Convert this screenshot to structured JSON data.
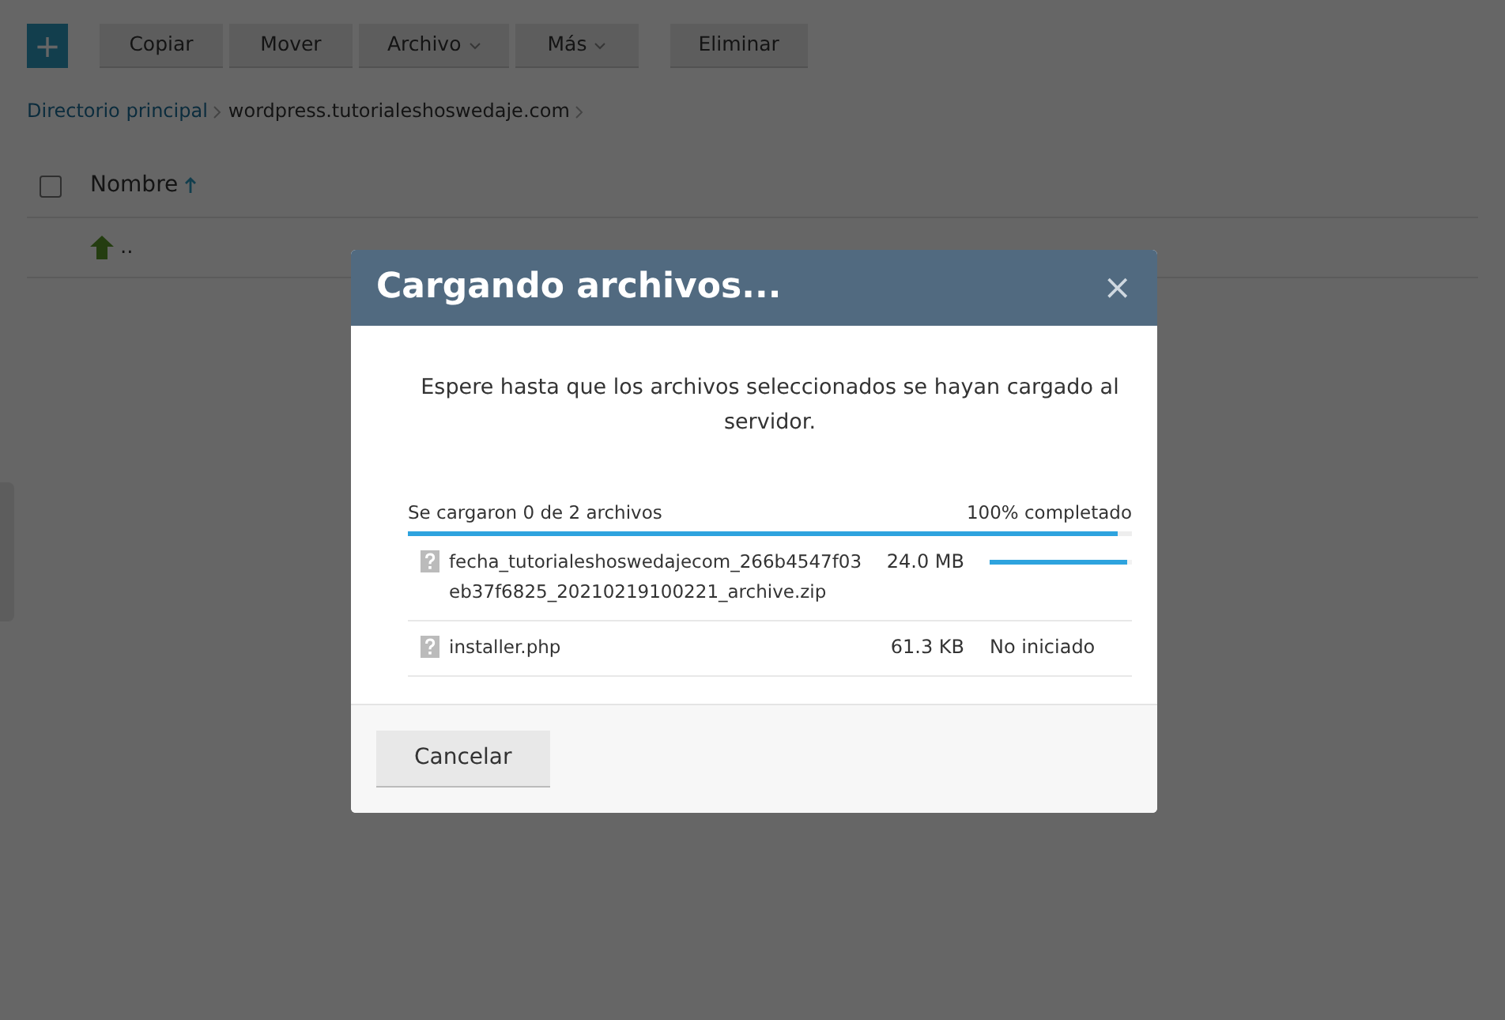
{
  "toolbar": {
    "add_button": "+",
    "buttons": [
      {
        "label": "Copiar",
        "kind": "plain"
      },
      {
        "label": "Mover",
        "kind": "plain"
      },
      {
        "label": "Archivo",
        "kind": "dropdown"
      },
      {
        "label": "Más",
        "kind": "dropdown"
      },
      {
        "label": "Eliminar",
        "kind": "plain"
      }
    ]
  },
  "breadcrumb": [
    {
      "label": "Directorio principal",
      "kind": "link"
    },
    {
      "label": "wordpress.tutorialeshoswedaje.com",
      "kind": "current"
    }
  ],
  "file_list": {
    "select_all_checked": false,
    "columns": [
      {
        "label": "Nombre",
        "sorted_ascending": true
      }
    ],
    "rows": [
      {
        "name": ".."
      }
    ]
  },
  "modal": {
    "title": "Cargando archivos...",
    "close": "×",
    "message": "Espere hasta que los archivos seleccionados se hayan cargado al servidor.",
    "summary": "Se cargaron 0 de 2 archivos",
    "percent": "100% completado",
    "level": 0.98,
    "files": [
      {
        "name": "fecha_tutorialeshoswedajecom_266b4547f03eb37f6825_20210219100221_archive.zip",
        "size": "24.0 MB",
        "kind": "progress",
        "level": 0.97
      },
      {
        "name": "installer.php",
        "size": "61.3 KB",
        "kind": "status",
        "status": "No iniciado"
      }
    ],
    "cancel_button": "Cancelar"
  }
}
